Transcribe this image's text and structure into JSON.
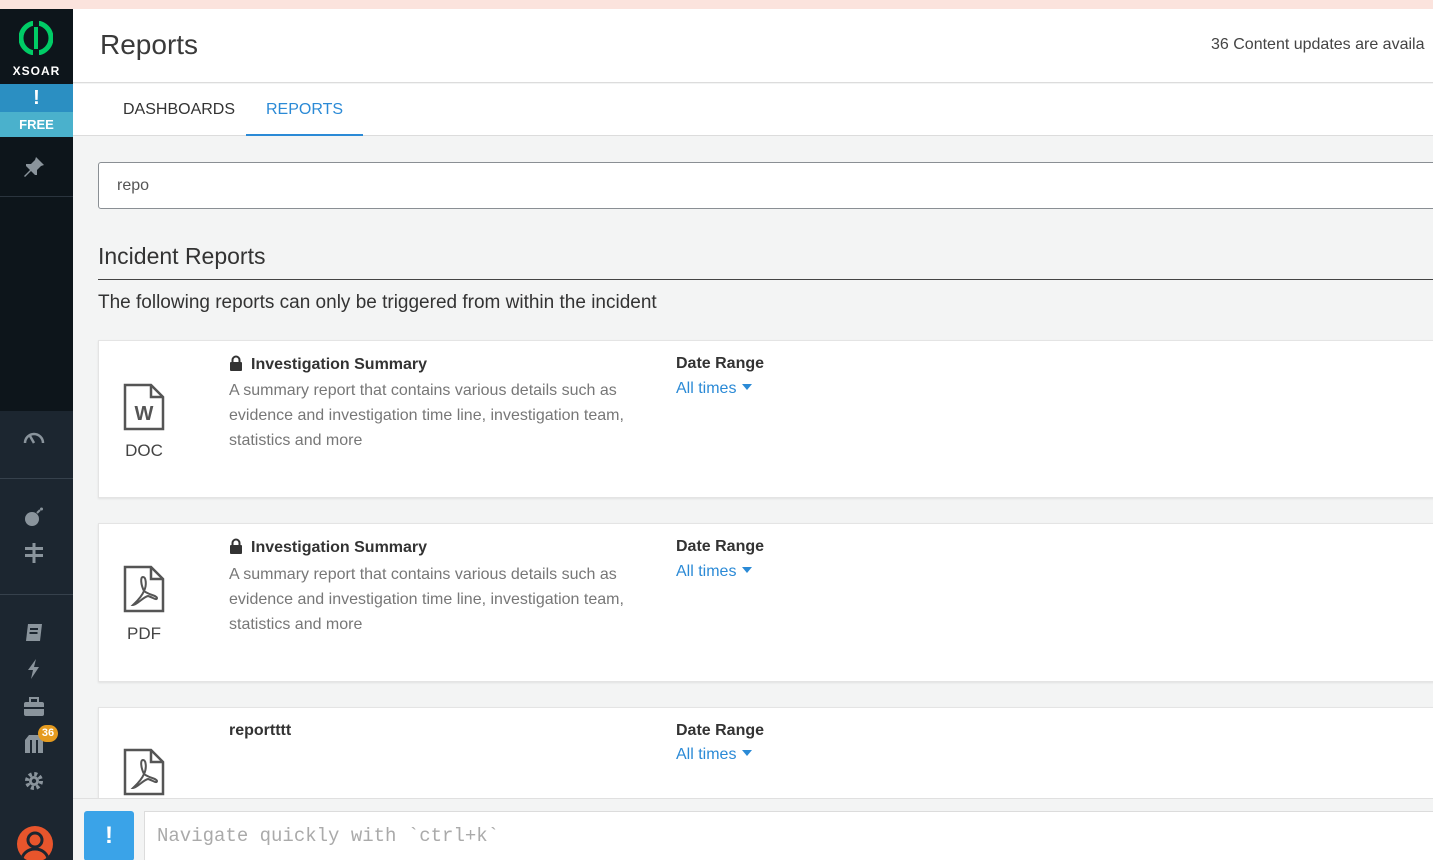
{
  "app": {
    "logo_text": "XSOAR",
    "alert_mark": "!",
    "free_label": "FREE",
    "marketplace_badge": "36",
    "brand_color": "#00cc66"
  },
  "header": {
    "title": "Reports",
    "updates_text": "36 Content updates are availa"
  },
  "tabs": [
    {
      "label": "DASHBOARDS",
      "active": false
    },
    {
      "label": "REPORTS",
      "active": true
    }
  ],
  "search": {
    "value": "repo"
  },
  "section": {
    "title": "Incident Reports",
    "subtitle": "The following reports can only be triggered from within the incident"
  },
  "reports": [
    {
      "format": "DOC",
      "icon": "word-doc-icon",
      "locked": true,
      "title": "Investigation Summary",
      "description": "A summary report that contains various details such as evidence and investigation time line, investigation team, statistics and more",
      "date_range_label": "Date Range",
      "date_range_value": "All times"
    },
    {
      "format": "PDF",
      "icon": "pdf-icon",
      "locked": true,
      "title": "Investigation Summary",
      "description": "A summary report that contains various details such as evidence and investigation time line, investigation team, statistics and more",
      "date_range_label": "Date Range",
      "date_range_value": "All times"
    },
    {
      "format": "PDF",
      "icon": "pdf-icon",
      "locked": false,
      "title": "reportttt",
      "description": "",
      "date_range_label": "Date Range",
      "date_range_value": "All times"
    }
  ],
  "cli": {
    "button_label": "!",
    "placeholder": "Navigate quickly with `ctrl+k`"
  }
}
